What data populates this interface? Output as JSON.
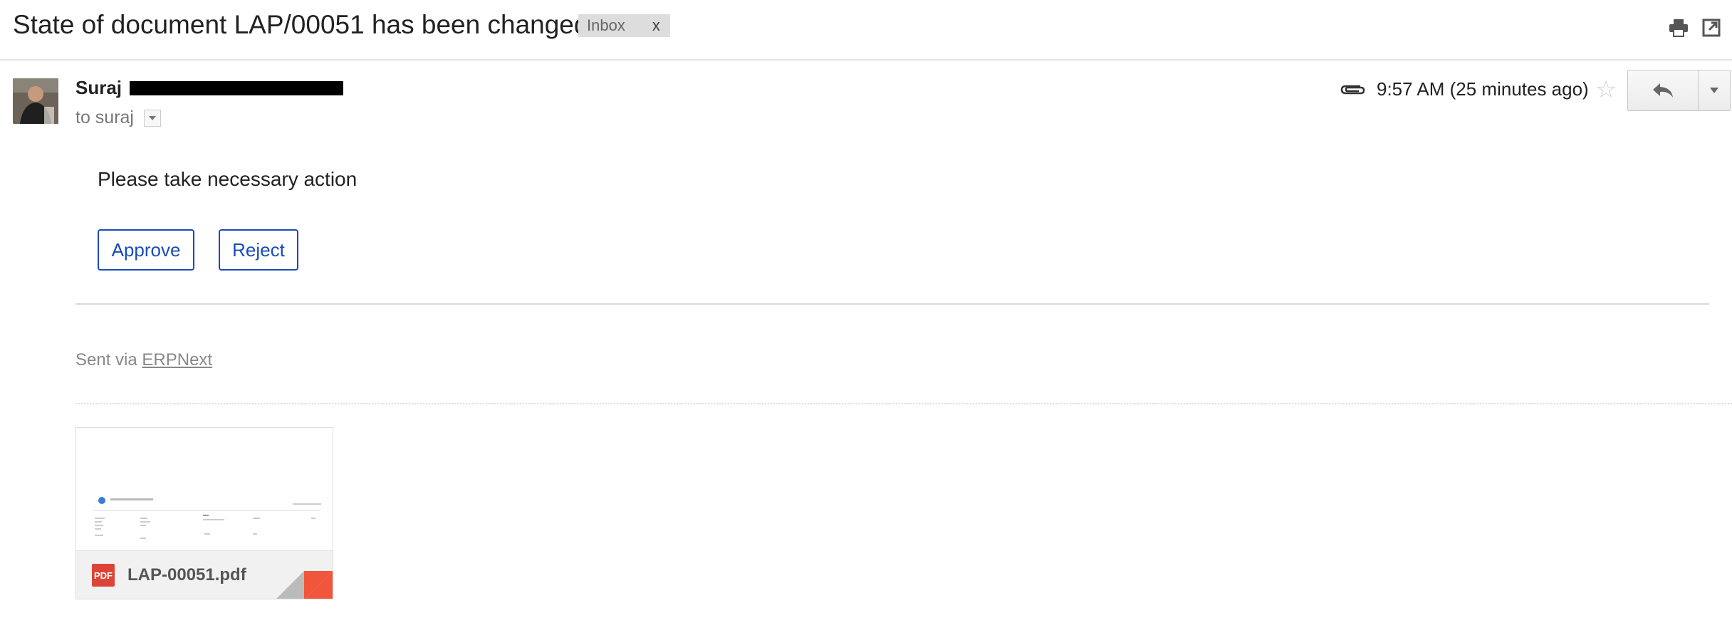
{
  "header": {
    "subject": "State of document LAP/00051 has been changed",
    "label": "Inbox",
    "label_remove": "x"
  },
  "message": {
    "sender_name": "Suraj",
    "recipient": "to suraj",
    "time": "9:57 AM (25 minutes ago)",
    "body": "Please take necessary action",
    "approve_label": "Approve",
    "reject_label": "Reject",
    "sent_via_prefix": "Sent via",
    "sent_via_link": "ERPNext"
  },
  "attachment": {
    "file_name": "LAP-00051.pdf",
    "type_badge": "PDF"
  },
  "colors": {
    "accent_blue": "#1a4bb8",
    "pdf_red": "#db4437",
    "corner_orange": "#f0563b"
  },
  "icons": [
    "print-icon",
    "open-new-window-icon",
    "attachment-icon",
    "star-icon",
    "reply-icon",
    "more-options-icon",
    "pdf-icon"
  ]
}
